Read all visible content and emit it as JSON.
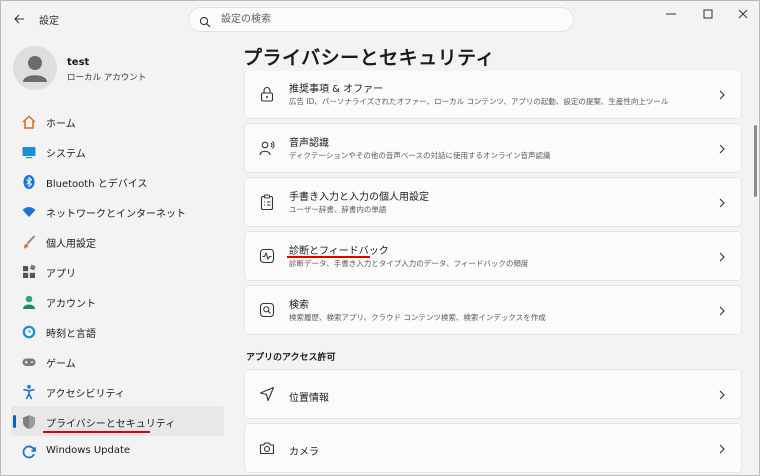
{
  "window": {
    "app_title": "設定",
    "search_placeholder": "設定の検索"
  },
  "user": {
    "name": "test",
    "account_type": "ローカル アカウント"
  },
  "sidebar": {
    "items": [
      {
        "label": "ホーム",
        "icon": "home-icon"
      },
      {
        "label": "システム",
        "icon": "system-icon"
      },
      {
        "label": "Bluetooth とデバイス",
        "icon": "bluetooth-icon"
      },
      {
        "label": "ネットワークとインターネット",
        "icon": "network-icon"
      },
      {
        "label": "個人用設定",
        "icon": "personalization-icon"
      },
      {
        "label": "アプリ",
        "icon": "apps-icon"
      },
      {
        "label": "アカウント",
        "icon": "account-icon"
      },
      {
        "label": "時刻と言語",
        "icon": "time-language-icon"
      },
      {
        "label": "ゲーム",
        "icon": "gaming-icon"
      },
      {
        "label": "アクセシビリティ",
        "icon": "accessibility-icon"
      },
      {
        "label": "プライバシーとセキュリティ",
        "icon": "privacy-shield-icon",
        "selected": true
      },
      {
        "label": "Windows Update",
        "icon": "windows-update-icon"
      }
    ]
  },
  "main": {
    "title": "プライバシーとセキュリティ",
    "cards": [
      {
        "title": "推奨事項 & オファー",
        "desc": "広告 ID、パーソナライズされたオファー、ローカル コンテンツ、アプリの起動、設定の提案、生産性向上ツール",
        "icon": "lock-icon"
      },
      {
        "title": "音声認識",
        "desc": "ディクテーションやその他の音声ベースの対話に使用するオンライン音声認識",
        "icon": "speech-icon"
      },
      {
        "title": "手書き入力と入力の個人用設定",
        "desc": "ユーザー辞書、辞書内の単語",
        "icon": "clipboard-list-icon"
      },
      {
        "title": "診断とフィードバック",
        "desc": "診断データ、手書き入力とタイプ入力のデータ、フィードバックの頻度",
        "icon": "diagnostics-icon"
      },
      {
        "title": "検索",
        "desc": "検索履歴、検索アプリ、クラウド コンテンツ検索、検索インデックスを作成",
        "icon": "search-box-icon"
      }
    ],
    "app_permissions_header": "アプリのアクセス許可",
    "permission_cards": [
      {
        "title": "位置情報",
        "icon": "location-icon"
      },
      {
        "title": "カメラ",
        "icon": "camera-icon"
      }
    ]
  },
  "colors": {
    "accent": "#0067c0",
    "annotation_underline": "#e00000"
  }
}
